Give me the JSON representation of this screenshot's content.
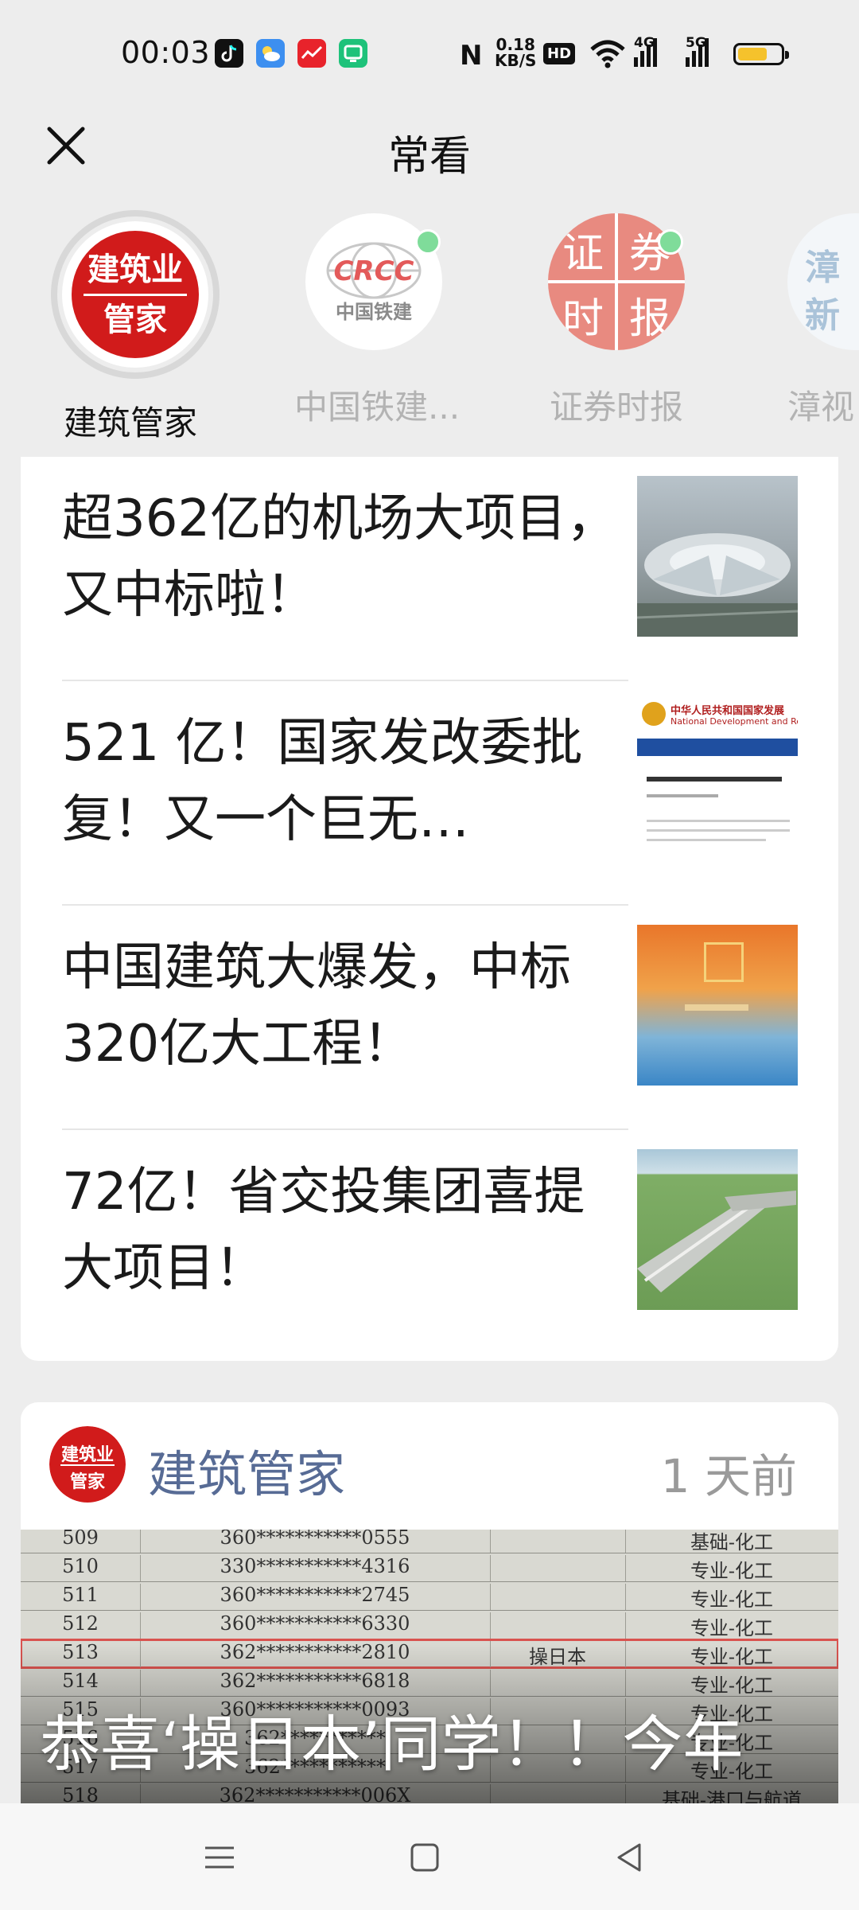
{
  "status_bar": {
    "time": "00:03",
    "net_speed_value": "0.18",
    "net_speed_unit": "KB/S",
    "hd_label": "HD",
    "signal1": "4G",
    "signal2": "5G",
    "battery_level": 0.7
  },
  "header": {
    "title": "常看"
  },
  "accounts": [
    {
      "name": "建筑管家",
      "logo_text": [
        "建筑业",
        "管家"
      ],
      "active": true,
      "has_update": false
    },
    {
      "name": "中国铁建...",
      "logo_text": [
        "CRCC",
        "中国铁建"
      ],
      "active": false,
      "has_update": true
    },
    {
      "name": "证券时报",
      "logo_text": [
        "证",
        "券",
        "时",
        "报"
      ],
      "active": false,
      "has_update": true
    },
    {
      "name": "漳视",
      "logo_text": [
        "漳",
        "新"
      ],
      "active": false,
      "has_update": false
    }
  ],
  "articles": [
    {
      "title": "超362亿的机场大项目，又中标啦！"
    },
    {
      "title": "521 亿！国家发改委批复！又一个巨无…"
    },
    {
      "title": "中国建筑大爆发，中标320亿大工程！"
    },
    {
      "title": "72亿！省交投集团喜提大项目！"
    }
  ],
  "thumb2_caption": "中华人民共和国国家发展",
  "thumb2_sub": "National Development and Ref",
  "feed_post": {
    "account": "建筑管家",
    "time_ago": "1 天前",
    "title": "恭喜‘操日本’同学！！今年",
    "table_rows": [
      [
        "509",
        "360***********0555",
        "",
        "基础-化工"
      ],
      [
        "510",
        "330***********4316",
        "",
        "专业-化工"
      ],
      [
        "511",
        "360***********2745",
        "",
        "专业-化工"
      ],
      [
        "512",
        "360***********6330",
        "",
        "专业-化工"
      ],
      [
        "513",
        "362***********2810",
        "操日本",
        "专业-化工"
      ],
      [
        "514",
        "362***********6818",
        "",
        "专业-化工"
      ],
      [
        "515",
        "360***********0093",
        "",
        "专业-化工"
      ],
      [
        "516",
        "362***********",
        "",
        "专业-化工"
      ],
      [
        "517",
        "362***********",
        "",
        "专业-化工"
      ],
      [
        "518",
        "362***********006X",
        "",
        "基础-港口与航道"
      ]
    ]
  },
  "colors": {
    "accent_blue": "#576b95",
    "logo_red": "#d11b1b",
    "update_dot": "#7fdc9a"
  }
}
